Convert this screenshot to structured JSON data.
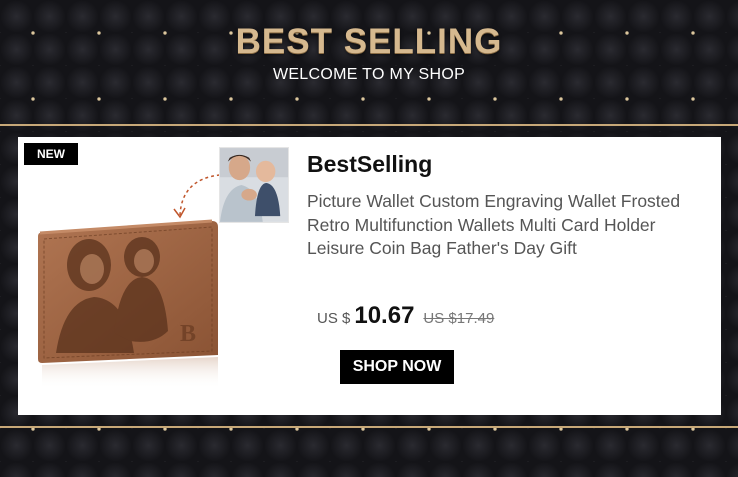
{
  "banner": {
    "headline": "BEST SELLING",
    "subheadline": "WELCOME TO MY SHOP"
  },
  "product": {
    "badge": "NEW",
    "title": "BestSelling",
    "description": "Picture Wallet Custom Engraving Wallet Frosted Retro Multifunction Wallets Multi Card Holder Leisure Coin Bag Father's Day Gift",
    "currency_label": "US $",
    "price": "10.67",
    "original_price": "US $17.49",
    "cta_label": "SHOP NOW",
    "image": "engraved-photo-wallet",
    "thumbnail_image": "father-and-baby-photo"
  },
  "colors": {
    "accent_gold": "#d6b98f",
    "background": "#15151a",
    "wallet_brown": "#9c6340"
  }
}
